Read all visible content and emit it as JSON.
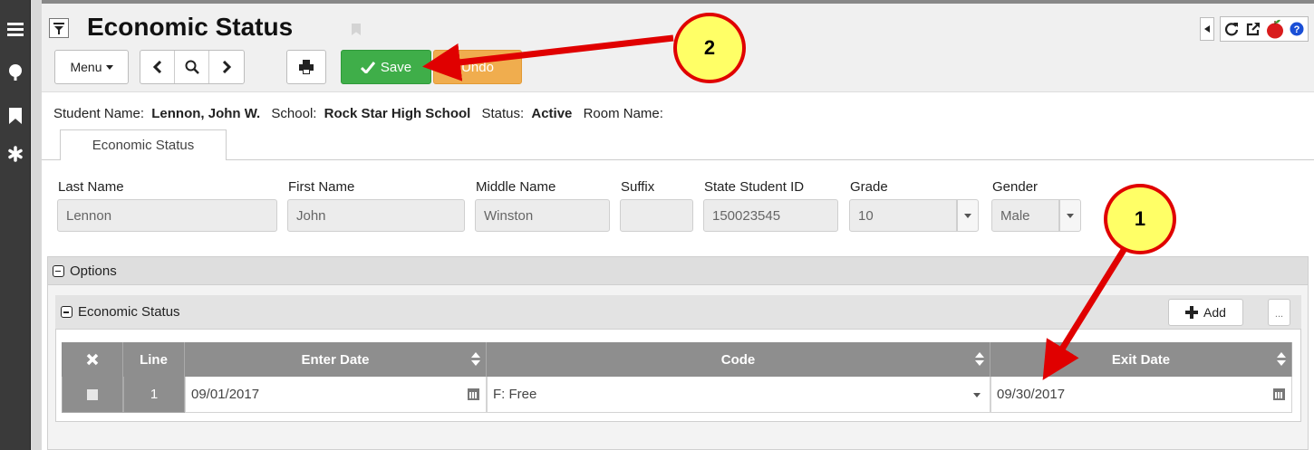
{
  "sidebar": {
    "icons": [
      "menu-icon",
      "tree-icon",
      "bookmark-icon",
      "asterisk-icon"
    ]
  },
  "header": {
    "title": "Economic Status",
    "menu_label": "Menu",
    "save_label": "Save",
    "undo_label": "Undo",
    "right_icons": [
      "collapse-arrow-icon",
      "refresh-icon",
      "external-link-icon",
      "apple-icon",
      "help-icon"
    ]
  },
  "student_info": {
    "name_label": "Student Name:",
    "name_value": "Lennon, John W.",
    "school_label": "School:",
    "school_value": "Rock Star High School",
    "status_label": "Status:",
    "status_value": "Active",
    "room_label": "Room Name:",
    "room_value": ""
  },
  "tabs": [
    {
      "label": "Economic Status",
      "active": true
    }
  ],
  "fields": {
    "last_name": {
      "label": "Last Name",
      "value": "Lennon"
    },
    "first_name": {
      "label": "First Name",
      "value": "John"
    },
    "middle_name": {
      "label": "Middle Name",
      "value": "Winston"
    },
    "suffix": {
      "label": "Suffix",
      "value": ""
    },
    "state_id": {
      "label": "State Student ID",
      "value": "150023545"
    },
    "grade": {
      "label": "Grade",
      "value": "10"
    },
    "gender": {
      "label": "Gender",
      "value": "Male"
    }
  },
  "options_panel": {
    "title": "Options",
    "sub_panel": {
      "title": "Economic Status",
      "add_label": "Add",
      "more_label": "..."
    }
  },
  "grid": {
    "columns": [
      "",
      "Line",
      "Enter Date",
      "Code",
      "Exit Date"
    ],
    "rows": [
      {
        "line": "1",
        "enter_date": "09/01/2017",
        "code": "F: Free",
        "exit_date": "09/30/2017"
      }
    ]
  },
  "annotations": {
    "callout_1": "1",
    "callout_2": "2",
    "color": "#e00000"
  }
}
